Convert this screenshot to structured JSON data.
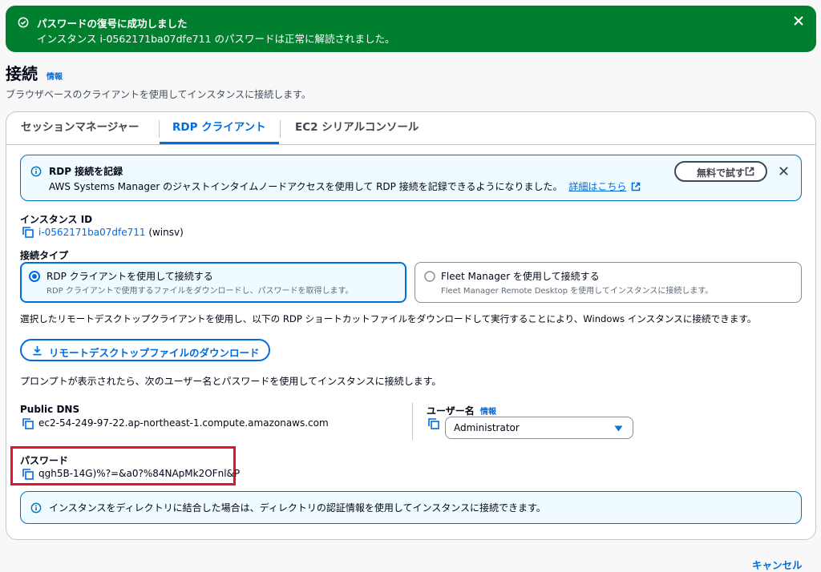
{
  "flash": {
    "title": "パスワードの復号に成功しました",
    "message": "インスタンス i-0562171ba07dfe711 のパスワードは正常に解読されました。",
    "color": "#00802f"
  },
  "header": {
    "title": "接続",
    "info": "情報",
    "description": "ブラウザベースのクライアントを使用してインスタンスに接続します。"
  },
  "tabs": [
    {
      "label": "セッションマネージャー"
    },
    {
      "label": "RDP クライアント",
      "active": true
    },
    {
      "label": "EC2 シリアルコンソール"
    }
  ],
  "rdp_alert": {
    "title": "RDP 接続を記録",
    "message": "AWS Systems Manager のジャストインタイムノードアクセスを使用して RDP 接続を記録できるようになりました。",
    "link": "詳細はこちら",
    "try_button": "無料で試す"
  },
  "instance": {
    "label": "インスタンス ID",
    "id": "i-0562171ba07dfe711",
    "name": "(winsv)"
  },
  "connection_type": {
    "label": "接続タイプ",
    "options": [
      {
        "title": "RDP クライアントを使用して接続する",
        "desc": "RDP クライアントで使用するファイルをダウンロードし、パスワードを取得します。",
        "selected": true
      },
      {
        "title": "Fleet Manager を使用して接続する",
        "desc": "Fleet Manager Remote Desktop を使用してインスタンスに接続します。",
        "selected": false
      }
    ]
  },
  "instructions": "選択したリモートデスクトップクライアントを使用し、以下の RDP ショートカットファイルをダウンロードして実行することにより、Windows インスタンスに接続できます。",
  "download_button": "リモートデスクトップファイルのダウンロード",
  "prompt_text": "プロンプトが表示されたら、次のユーザー名とパスワードを使用してインスタンスに接続します。",
  "public_dns": {
    "label": "Public DNS",
    "value": "ec2-54-249-97-22.ap-northeast-1.compute.amazonaws.com"
  },
  "username": {
    "label": "ユーザー名",
    "info": "情報",
    "value": "Administrator"
  },
  "password": {
    "label": "パスワード",
    "value": "qgh5B-14G)%?=&a0?%84NApMk2OFnl&P"
  },
  "directory_alert": {
    "message": "インスタンスをディレクトリに結合した場合は、ディレクトリの認証情報を使用してインスタンスに接続できます。"
  },
  "footer": {
    "cancel": "キャンセル"
  },
  "colors": {
    "accent": "#006ce0",
    "success": "#00802f",
    "info_bg": "#f0fbff",
    "highlight": "#e8112d"
  }
}
